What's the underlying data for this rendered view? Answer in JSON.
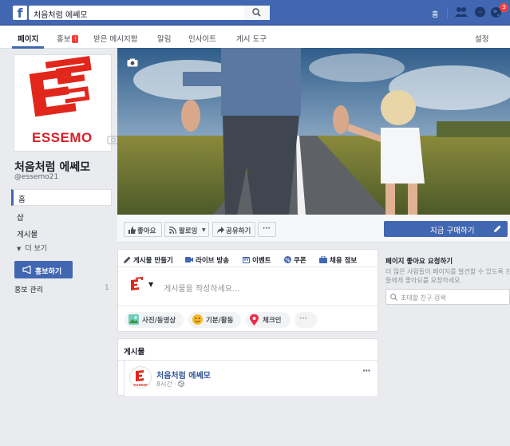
{
  "topbar": {
    "search_value": "처음처럼 에쎄모",
    "home_label": "홈",
    "notification_count": "3",
    "brand_color": "#4267b2"
  },
  "nav": {
    "page": "페이지",
    "promote": "홍보",
    "promote_badge": "!",
    "inbox": "받은 메시지함",
    "notifications": "알림",
    "insights": "인사이트",
    "publishing_tools": "게시 도구",
    "settings": "설정"
  },
  "sidebar": {
    "logo_text": "ESSEMO",
    "page_name": "처음처럼 에쎄모",
    "handle": "@essemo21",
    "items": [
      "홈",
      "샵",
      "게시물"
    ],
    "more": "더 보기",
    "promote_button": "홍보하기",
    "manage_promotions": "홍보 관리",
    "manage_count": "1"
  },
  "actions": {
    "like": "좋아요",
    "follow": "팔로잉",
    "share": "공유하기",
    "more": "···",
    "buy_now": "지금 구매하기"
  },
  "composer": {
    "tabs": [
      "게시물 만들기",
      "라이브 방송",
      "이벤트",
      "쿠폰",
      "채용 정보"
    ],
    "placeholder": "게시물을 작성하세요...",
    "pills": [
      "사진/동영상",
      "기분/활동",
      "체크인",
      "···"
    ]
  },
  "posts": {
    "title": "게시물",
    "author": "처음처럼 에쎄모",
    "time": "8시간 ·",
    "more": "···"
  },
  "right": {
    "title": "페이지 좋아요 요청하기",
    "desc_line1": "더 많은 사람들이 페이지를 발견할 수 있도록 친구",
    "desc_line2": "들에게 좋아요를 요청하세요.",
    "search_placeholder": "초대할 친구 검색"
  }
}
